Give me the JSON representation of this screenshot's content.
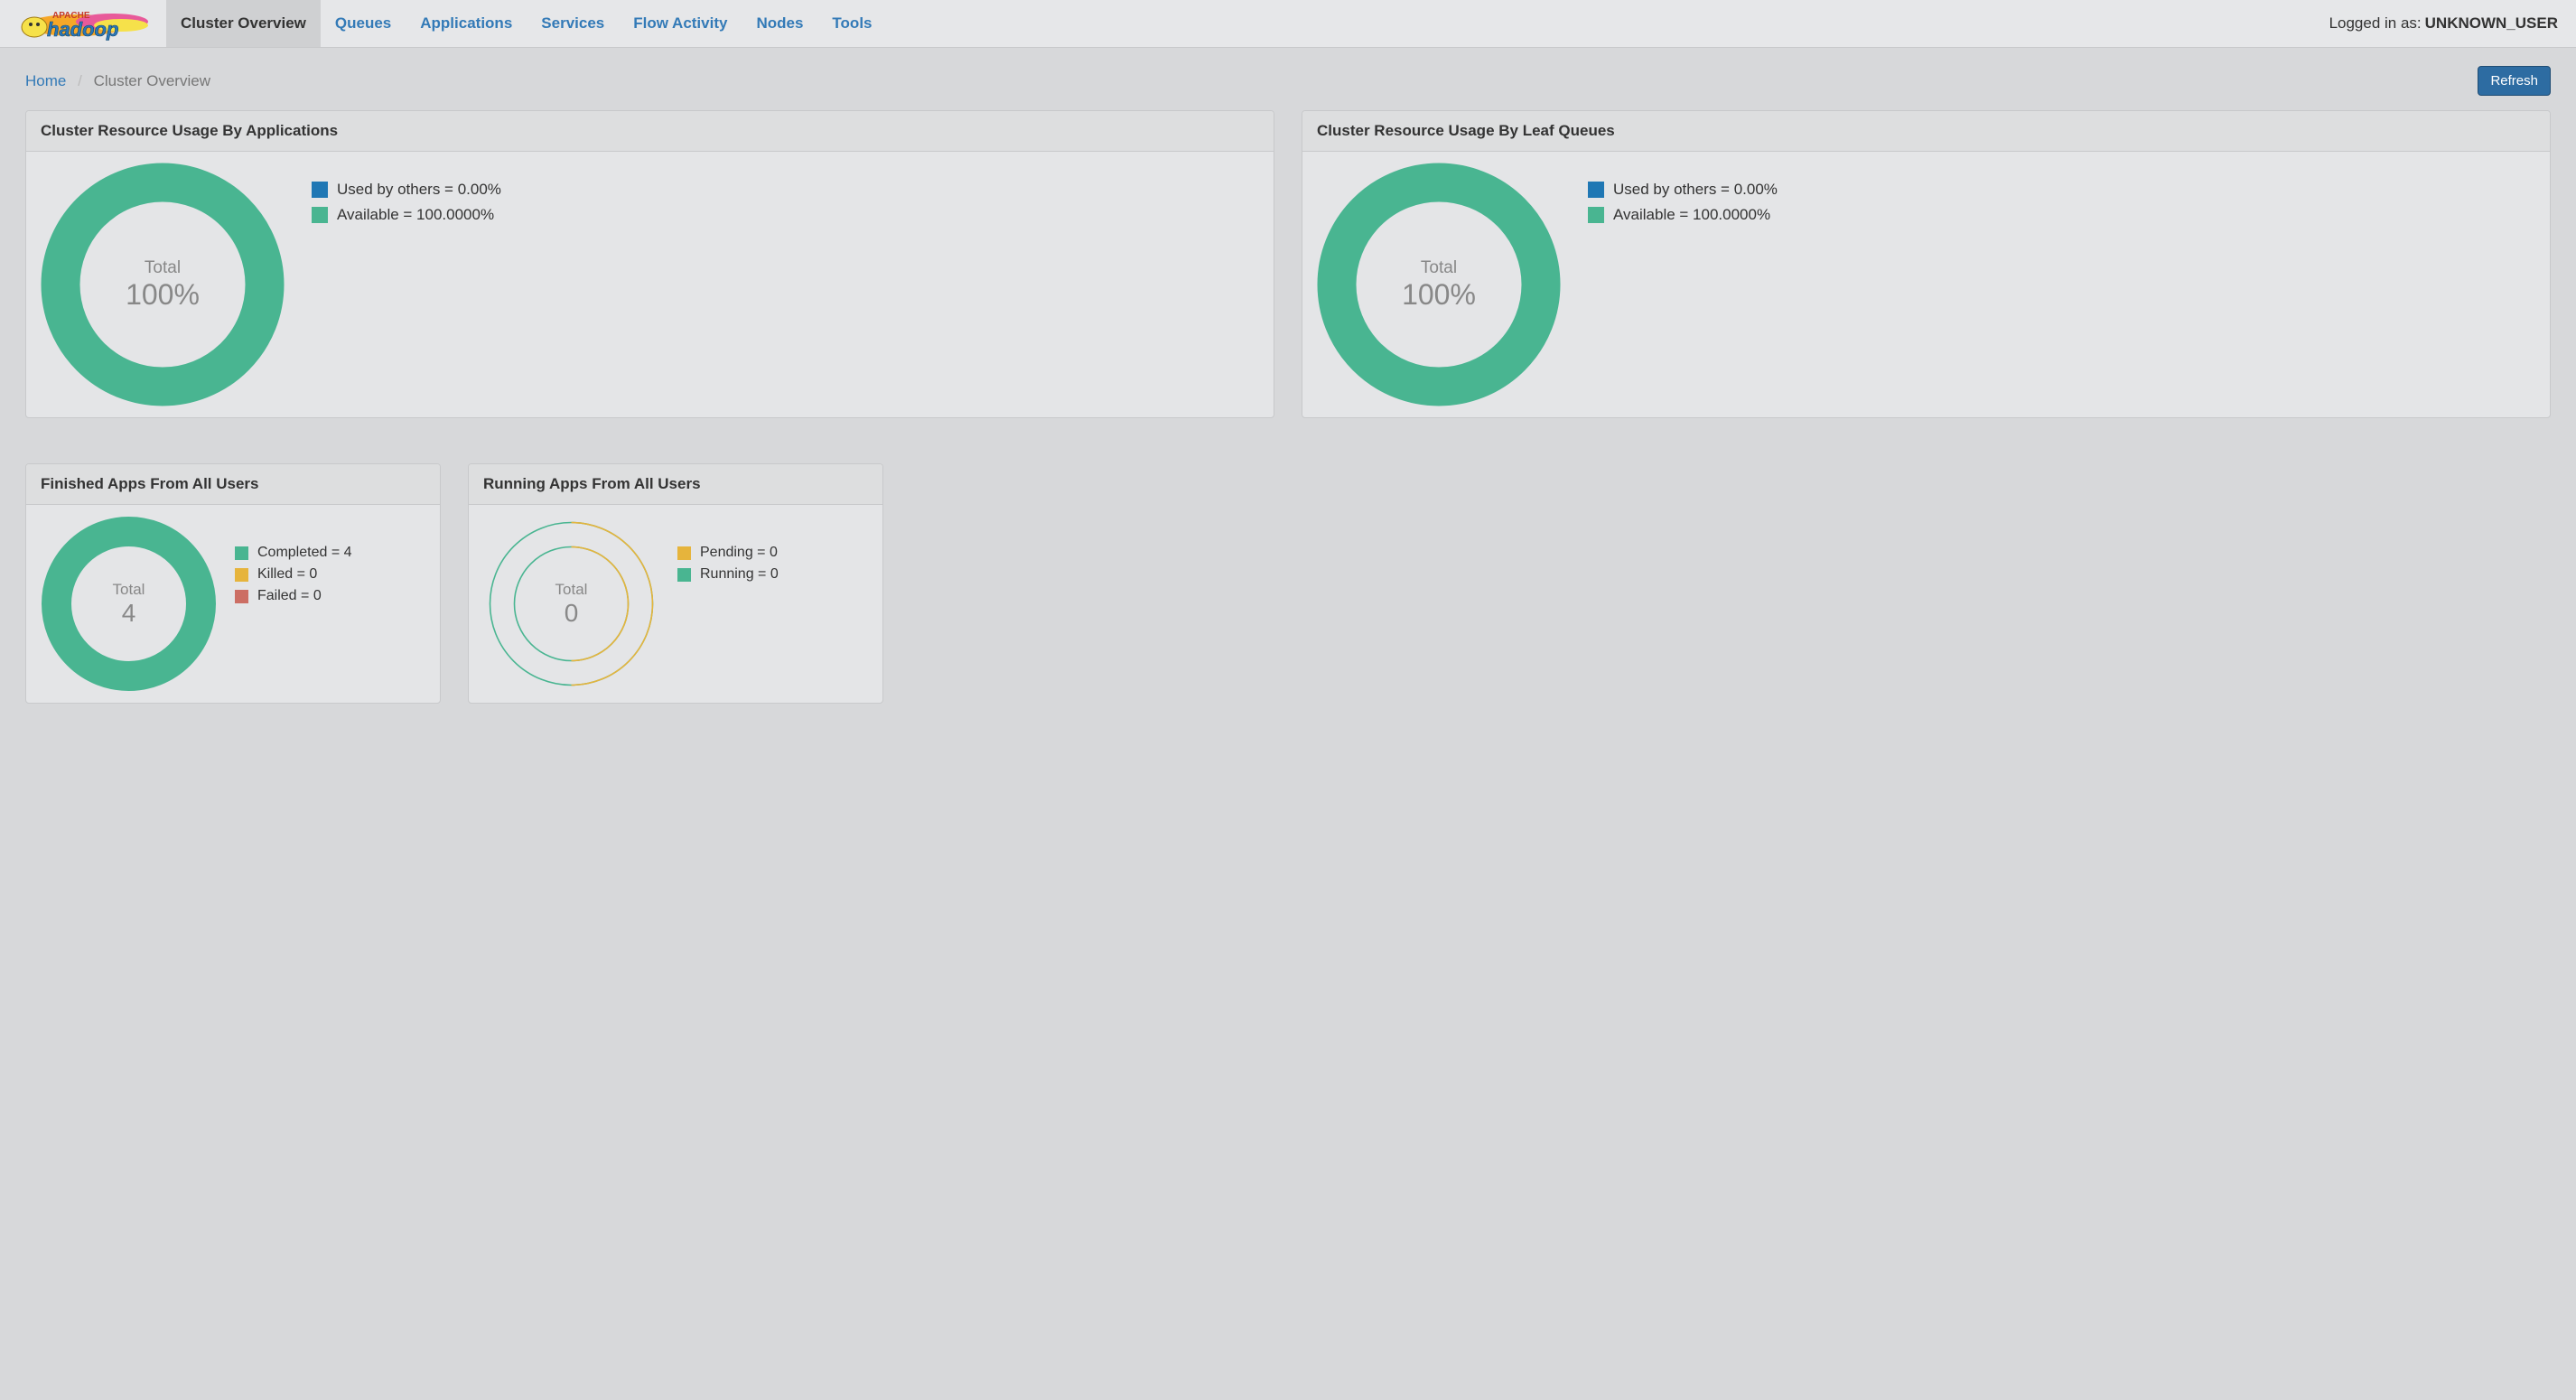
{
  "nav": {
    "items": [
      {
        "label": "Cluster Overview",
        "active": true
      },
      {
        "label": "Queues"
      },
      {
        "label": "Applications"
      },
      {
        "label": "Services"
      },
      {
        "label": "Flow Activity"
      },
      {
        "label": "Nodes"
      },
      {
        "label": "Tools"
      }
    ],
    "logged_in_prefix": "Logged in as: ",
    "logged_in_user": "UNKNOWN_USER"
  },
  "breadcrumb": {
    "home": "Home",
    "current": "Cluster Overview"
  },
  "refresh_label": "Refresh",
  "panels": {
    "apps_usage": {
      "title": "Cluster Resource Usage By Applications",
      "center_label": "Total",
      "center_value": "100%",
      "legend": [
        {
          "color": "#1f77b4",
          "text": "Used by others = 0.00%"
        },
        {
          "color": "#49b591",
          "text": "Available = 100.0000%"
        }
      ]
    },
    "queues_usage": {
      "title": "Cluster Resource Usage By Leaf Queues",
      "center_label": "Total",
      "center_value": "100%",
      "legend": [
        {
          "color": "#1f77b4",
          "text": "Used by others = 0.00%"
        },
        {
          "color": "#49b591",
          "text": "Available = 100.0000%"
        }
      ]
    },
    "finished": {
      "title": "Finished Apps From All Users",
      "center_label": "Total",
      "center_value": "4",
      "legend": [
        {
          "color": "#49b591",
          "text": "Completed = 4"
        },
        {
          "color": "#e6b43c",
          "text": "Killed = 0"
        },
        {
          "color": "#cc6e64",
          "text": "Failed = 0"
        }
      ]
    },
    "running": {
      "title": "Running Apps From All Users",
      "center_label": "Total",
      "center_value": "0",
      "legend": [
        {
          "color": "#e6b43c",
          "text": "Pending = 0"
        },
        {
          "color": "#49b591",
          "text": "Running = 0"
        }
      ]
    }
  },
  "chart_data": [
    {
      "type": "pie",
      "title": "Cluster Resource Usage By Applications",
      "series": [
        {
          "name": "Used by others",
          "value": 0.0,
          "unit": "%"
        },
        {
          "name": "Available",
          "value": 100.0,
          "unit": "%"
        }
      ],
      "total_label": "Total",
      "total_value": "100%"
    },
    {
      "type": "pie",
      "title": "Cluster Resource Usage By Leaf Queues",
      "series": [
        {
          "name": "Used by others",
          "value": 0.0,
          "unit": "%"
        },
        {
          "name": "Available",
          "value": 100.0,
          "unit": "%"
        }
      ],
      "total_label": "Total",
      "total_value": "100%"
    },
    {
      "type": "pie",
      "title": "Finished Apps From All Users",
      "series": [
        {
          "name": "Completed",
          "value": 4
        },
        {
          "name": "Killed",
          "value": 0
        },
        {
          "name": "Failed",
          "value": 0
        }
      ],
      "total_label": "Total",
      "total_value": 4
    },
    {
      "type": "pie",
      "title": "Running Apps From All Users",
      "series": [
        {
          "name": "Pending",
          "value": 0
        },
        {
          "name": "Running",
          "value": 0
        }
      ],
      "total_label": "Total",
      "total_value": 0
    }
  ]
}
